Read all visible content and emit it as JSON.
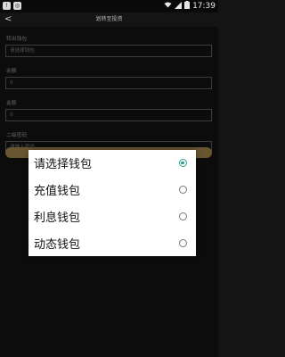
{
  "status_bar": {
    "time": "17:39",
    "left_icons": [
      "notification-icon",
      "cast-icon"
    ],
    "right_icons": [
      "wifi-icon",
      "signal-icon",
      "battery-icon"
    ]
  },
  "header": {
    "title": "划转至投资"
  },
  "form": {
    "fields": [
      {
        "label": "转出钱包",
        "value": "请选择钱包"
      },
      {
        "label": "余额",
        "value": "0"
      },
      {
        "label": "金额",
        "value": "0"
      },
      {
        "label": "二级密码",
        "placeholder": "请输入密码"
      }
    ]
  },
  "dialog": {
    "options": [
      {
        "label": "请选择钱包",
        "selected": true
      },
      {
        "label": "充值钱包",
        "selected": false
      },
      {
        "label": "利息钱包",
        "selected": false
      },
      {
        "label": "动态钱包",
        "selected": false
      }
    ]
  },
  "colors": {
    "accent_gold": "#b08f52",
    "radio_checked": "#2e9d8f",
    "background": "#141414"
  }
}
